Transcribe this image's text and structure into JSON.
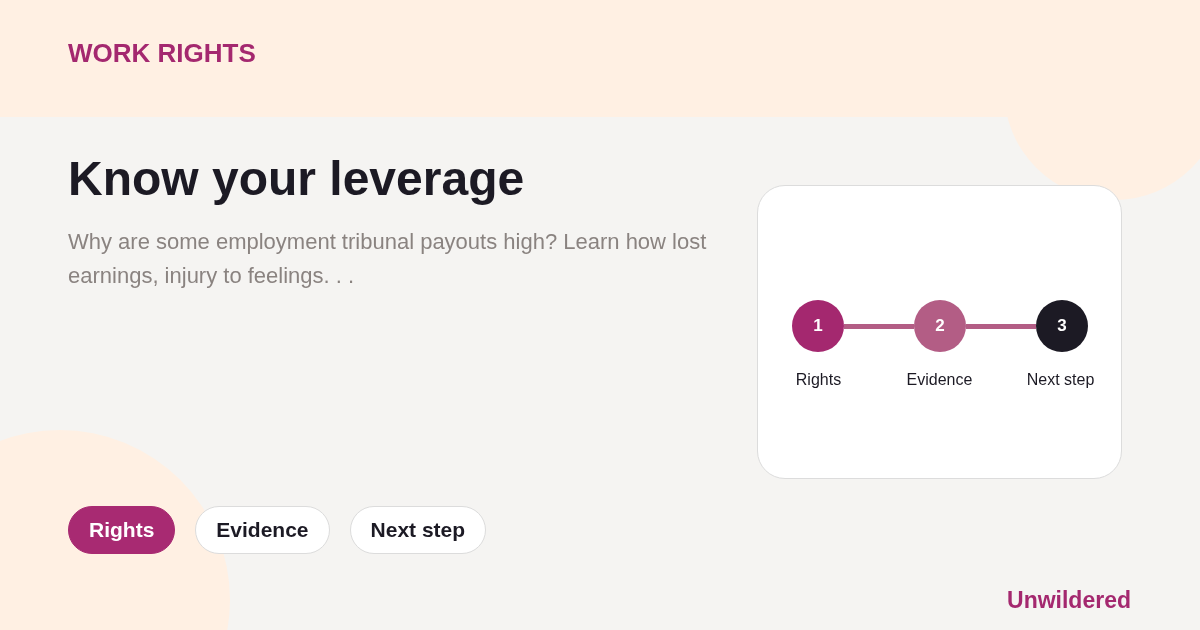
{
  "brand": "WORK RIGHTS",
  "headline": "Know your leverage",
  "summary": "Why are some employment tribunal payouts high? Learn how lost earnings, injury to feelings. . .",
  "steps": [
    {
      "number": "1",
      "label": "Rights",
      "color": "#a4286f"
    },
    {
      "number": "2",
      "label": "Evidence",
      "color": "#b35d85"
    },
    {
      "number": "3",
      "label": "Next step",
      "color": "#1c1a24"
    }
  ],
  "pills": [
    {
      "label": "Rights",
      "selected": true
    },
    {
      "label": "Evidence",
      "selected": false
    },
    {
      "label": "Next step",
      "selected": false
    }
  ],
  "footer": "Unwildered"
}
